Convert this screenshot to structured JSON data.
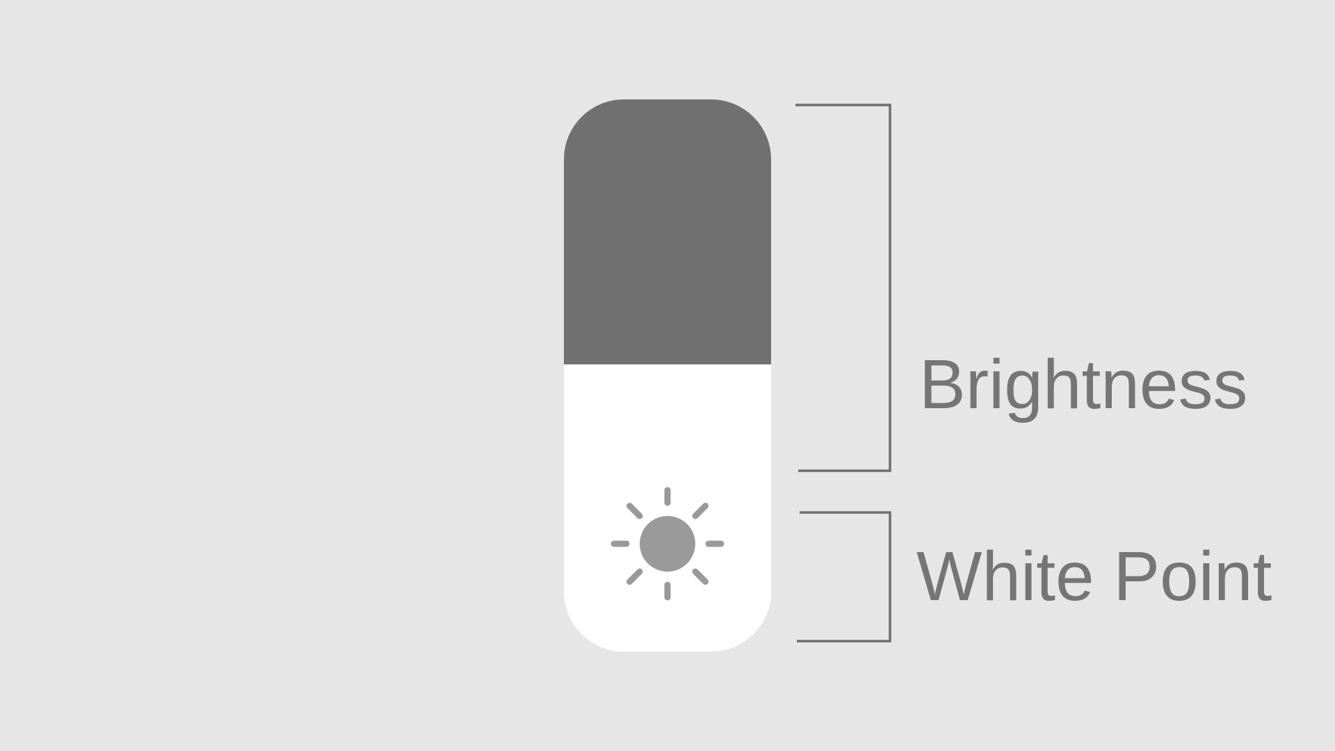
{
  "labels": {
    "brightness": "Brightness",
    "white_point": "White Point"
  },
  "slider": {
    "level_fraction": 0.52
  },
  "colors": {
    "background": "#e6e6e6",
    "track": "#707070",
    "fill": "#ffffff",
    "icon": "#9a9a9a",
    "bracket": "#6e6e6e",
    "label_text": "#757575"
  },
  "icons": {
    "slider_icon": "sun-icon"
  }
}
